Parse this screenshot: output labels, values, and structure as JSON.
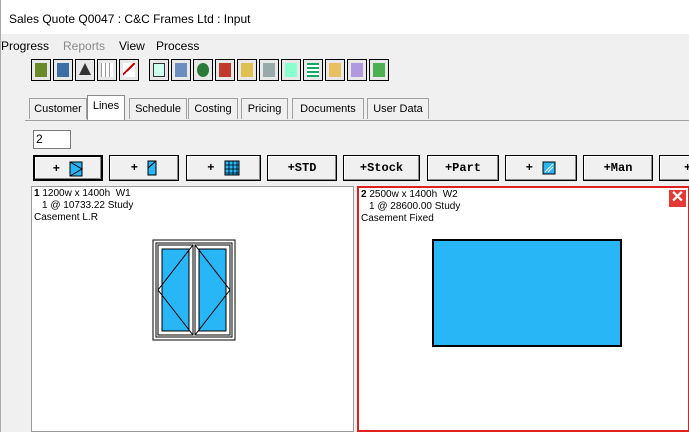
{
  "window": {
    "title": "Sales Quote Q0047   : C&C Frames Ltd : Input"
  },
  "menu": [
    "Progress",
    "Reports",
    "View",
    "Process"
  ],
  "toolbar_icons": [
    "save-icon",
    "doc-icon",
    "up-arrow-icon",
    "grid-icon",
    "chart-icon",
    "window-icon",
    "doc-window-icon",
    "globe-icon",
    "house-icon",
    "picture-icon",
    "chart-doc-icon",
    "pane-icon",
    "list-icon",
    "folder-icon",
    "report-icon",
    "check-doc-icon"
  ],
  "tabs": [
    "Customer",
    "Lines",
    "Schedule",
    "Costing",
    "Pricing",
    "Documents",
    "User Data"
  ],
  "active_tab": "Lines",
  "line_number": "2",
  "add_buttons": [
    {
      "label": "+",
      "icon": "casement-icon"
    },
    {
      "label": "+",
      "icon": "door-icon"
    },
    {
      "label": "+",
      "icon": "grid-window-icon"
    },
    {
      "label": "+STD",
      "icon": ""
    },
    {
      "label": "+Stock",
      "icon": ""
    },
    {
      "label": "+Part",
      "icon": ""
    },
    {
      "label": "+",
      "icon": "glass-icon"
    },
    {
      "label": "+Man",
      "icon": ""
    },
    {
      "label": "+",
      "icon": ""
    }
  ],
  "lines": [
    {
      "num": "1",
      "size": " 1200w x 1400h  W1",
      "qty_price": "1 @ 10733.22  Study",
      "style": "Casement L.R"
    },
    {
      "num": "2",
      "size": " 2500w x 1400h  W2",
      "qty_price": "1 @ 28600.00  Study",
      "style": "Casement Fixed"
    }
  ],
  "colors": {
    "glass": "#29b6f6",
    "selection": "#e02020",
    "close": "#e53935"
  }
}
